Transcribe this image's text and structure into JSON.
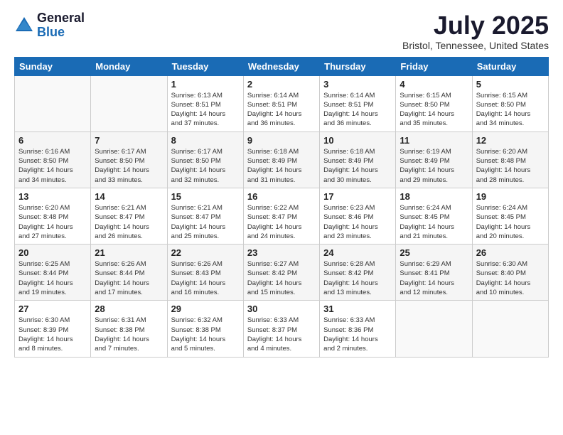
{
  "header": {
    "logo_general": "General",
    "logo_blue": "Blue",
    "month_title": "July 2025",
    "location": "Bristol, Tennessee, United States"
  },
  "weekdays": [
    "Sunday",
    "Monday",
    "Tuesday",
    "Wednesday",
    "Thursday",
    "Friday",
    "Saturday"
  ],
  "weeks": [
    [
      {
        "day": "",
        "info": ""
      },
      {
        "day": "",
        "info": ""
      },
      {
        "day": "1",
        "info": "Sunrise: 6:13 AM\nSunset: 8:51 PM\nDaylight: 14 hours\nand 37 minutes."
      },
      {
        "day": "2",
        "info": "Sunrise: 6:14 AM\nSunset: 8:51 PM\nDaylight: 14 hours\nand 36 minutes."
      },
      {
        "day": "3",
        "info": "Sunrise: 6:14 AM\nSunset: 8:51 PM\nDaylight: 14 hours\nand 36 minutes."
      },
      {
        "day": "4",
        "info": "Sunrise: 6:15 AM\nSunset: 8:50 PM\nDaylight: 14 hours\nand 35 minutes."
      },
      {
        "day": "5",
        "info": "Sunrise: 6:15 AM\nSunset: 8:50 PM\nDaylight: 14 hours\nand 34 minutes."
      }
    ],
    [
      {
        "day": "6",
        "info": "Sunrise: 6:16 AM\nSunset: 8:50 PM\nDaylight: 14 hours\nand 34 minutes."
      },
      {
        "day": "7",
        "info": "Sunrise: 6:17 AM\nSunset: 8:50 PM\nDaylight: 14 hours\nand 33 minutes."
      },
      {
        "day": "8",
        "info": "Sunrise: 6:17 AM\nSunset: 8:50 PM\nDaylight: 14 hours\nand 32 minutes."
      },
      {
        "day": "9",
        "info": "Sunrise: 6:18 AM\nSunset: 8:49 PM\nDaylight: 14 hours\nand 31 minutes."
      },
      {
        "day": "10",
        "info": "Sunrise: 6:18 AM\nSunset: 8:49 PM\nDaylight: 14 hours\nand 30 minutes."
      },
      {
        "day": "11",
        "info": "Sunrise: 6:19 AM\nSunset: 8:49 PM\nDaylight: 14 hours\nand 29 minutes."
      },
      {
        "day": "12",
        "info": "Sunrise: 6:20 AM\nSunset: 8:48 PM\nDaylight: 14 hours\nand 28 minutes."
      }
    ],
    [
      {
        "day": "13",
        "info": "Sunrise: 6:20 AM\nSunset: 8:48 PM\nDaylight: 14 hours\nand 27 minutes."
      },
      {
        "day": "14",
        "info": "Sunrise: 6:21 AM\nSunset: 8:47 PM\nDaylight: 14 hours\nand 26 minutes."
      },
      {
        "day": "15",
        "info": "Sunrise: 6:21 AM\nSunset: 8:47 PM\nDaylight: 14 hours\nand 25 minutes."
      },
      {
        "day": "16",
        "info": "Sunrise: 6:22 AM\nSunset: 8:47 PM\nDaylight: 14 hours\nand 24 minutes."
      },
      {
        "day": "17",
        "info": "Sunrise: 6:23 AM\nSunset: 8:46 PM\nDaylight: 14 hours\nand 23 minutes."
      },
      {
        "day": "18",
        "info": "Sunrise: 6:24 AM\nSunset: 8:45 PM\nDaylight: 14 hours\nand 21 minutes."
      },
      {
        "day": "19",
        "info": "Sunrise: 6:24 AM\nSunset: 8:45 PM\nDaylight: 14 hours\nand 20 minutes."
      }
    ],
    [
      {
        "day": "20",
        "info": "Sunrise: 6:25 AM\nSunset: 8:44 PM\nDaylight: 14 hours\nand 19 minutes."
      },
      {
        "day": "21",
        "info": "Sunrise: 6:26 AM\nSunset: 8:44 PM\nDaylight: 14 hours\nand 17 minutes."
      },
      {
        "day": "22",
        "info": "Sunrise: 6:26 AM\nSunset: 8:43 PM\nDaylight: 14 hours\nand 16 minutes."
      },
      {
        "day": "23",
        "info": "Sunrise: 6:27 AM\nSunset: 8:42 PM\nDaylight: 14 hours\nand 15 minutes."
      },
      {
        "day": "24",
        "info": "Sunrise: 6:28 AM\nSunset: 8:42 PM\nDaylight: 14 hours\nand 13 minutes."
      },
      {
        "day": "25",
        "info": "Sunrise: 6:29 AM\nSunset: 8:41 PM\nDaylight: 14 hours\nand 12 minutes."
      },
      {
        "day": "26",
        "info": "Sunrise: 6:30 AM\nSunset: 8:40 PM\nDaylight: 14 hours\nand 10 minutes."
      }
    ],
    [
      {
        "day": "27",
        "info": "Sunrise: 6:30 AM\nSunset: 8:39 PM\nDaylight: 14 hours\nand 8 minutes."
      },
      {
        "day": "28",
        "info": "Sunrise: 6:31 AM\nSunset: 8:38 PM\nDaylight: 14 hours\nand 7 minutes."
      },
      {
        "day": "29",
        "info": "Sunrise: 6:32 AM\nSunset: 8:38 PM\nDaylight: 14 hours\nand 5 minutes."
      },
      {
        "day": "30",
        "info": "Sunrise: 6:33 AM\nSunset: 8:37 PM\nDaylight: 14 hours\nand 4 minutes."
      },
      {
        "day": "31",
        "info": "Sunrise: 6:33 AM\nSunset: 8:36 PM\nDaylight: 14 hours\nand 2 minutes."
      },
      {
        "day": "",
        "info": ""
      },
      {
        "day": "",
        "info": ""
      }
    ]
  ]
}
